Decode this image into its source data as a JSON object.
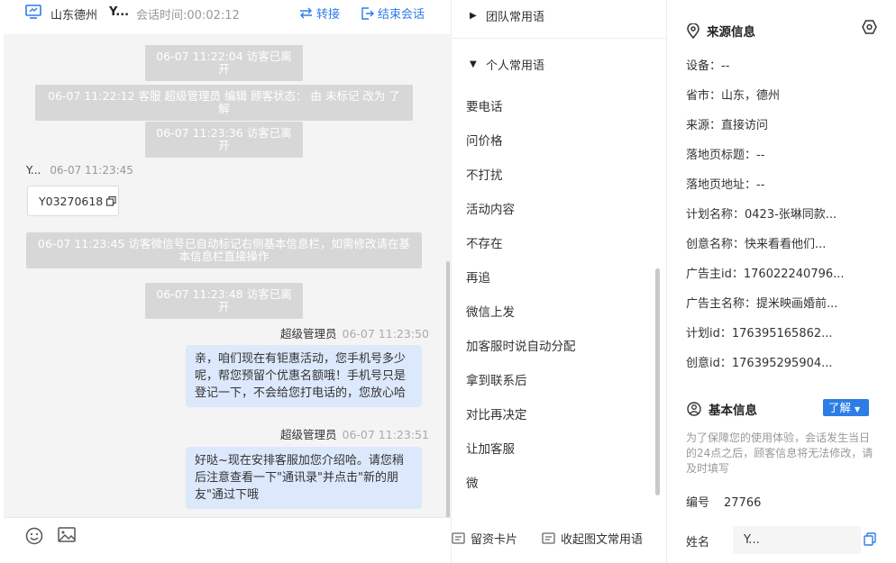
{
  "chat": {
    "header": {
      "location": "山东德州",
      "visitor": "Y...",
      "duration_label": "会话时间:",
      "duration": "00:02:12",
      "transfer": "转接",
      "end_chat": "结束会话"
    },
    "messages": {
      "sys1": "06-07 11:22:04 访客已离开",
      "sys2": "06-07 11:22:12 客服 超级管理员 编辑 顾客状态： 由 未标记 改为 了解",
      "sys3": "06-07 11:23:36 访客已离开",
      "visitor_name": "Y...",
      "visitor_time": "06-07 11:23:45",
      "visitor_id": "Y03270618",
      "sys4": "06-07 11:23:45 访客微信号已自动标记右侧基本信息栏，如需修改请在基本信息栏直接操作",
      "sys5": "06-07 11:23:48 访客已离开",
      "agent1_name": "超级管理员",
      "agent1_time": "06-07 11:23:50",
      "agent1_text": "亲，咱们现在有钜惠活动，您手机号多少呢，帮您预留个优惠名额哦！手机号只是登记一下，不会给您打电话的，您放心哈",
      "agent2_name": "超级管理员",
      "agent2_time": "06-07 11:23:51",
      "agent2_text": "好哒~现在安排客服加您介绍哈。请您稍后注意查看一下\"通讯录\"并点击\"新的朋友\"通过下哦"
    },
    "footer": {
      "leave_card": "留资卡片",
      "collapse": "收起图文常用语"
    }
  },
  "phrases": {
    "team_group": "团队常用语",
    "personal_group": "个人常用语",
    "items": [
      "要电话",
      "问价格",
      "不打扰",
      "活动内容",
      "不存在",
      "再追",
      "微信上发",
      "加客服时说自动分配",
      "拿到联系后",
      "对比再决定",
      "让加客服",
      "微"
    ]
  },
  "info": {
    "source_title": "来源信息",
    "source": [
      {
        "k": "设备：",
        "v": "--"
      },
      {
        "k": "省市：",
        "v": "山东，德州"
      },
      {
        "k": "来源：",
        "v": "直接访问"
      },
      {
        "k": "落地页标题：",
        "v": "--"
      },
      {
        "k": "落地页地址：",
        "v": "--"
      },
      {
        "k": "计划名称：",
        "v": "0423-张琳同款..."
      },
      {
        "k": "创意名称：",
        "v": "快来看看他们..."
      },
      {
        "k": "广告主id：",
        "v": "176022240796..."
      },
      {
        "k": "广告主名称：",
        "v": "提米映画婚前..."
      },
      {
        "k": "计划id：",
        "v": "176395165862..."
      },
      {
        "k": "创意id：",
        "v": "176395295904..."
      }
    ],
    "basic_title": "基本信息",
    "learn_button": "了解",
    "notice": "为了保障您的使用体验，会话发生当日的24点之后，顾客信息将无法修改，请及时填写",
    "number_label": "编号",
    "number_value": "27766",
    "name_label": "姓名",
    "name_value": "Y..."
  }
}
